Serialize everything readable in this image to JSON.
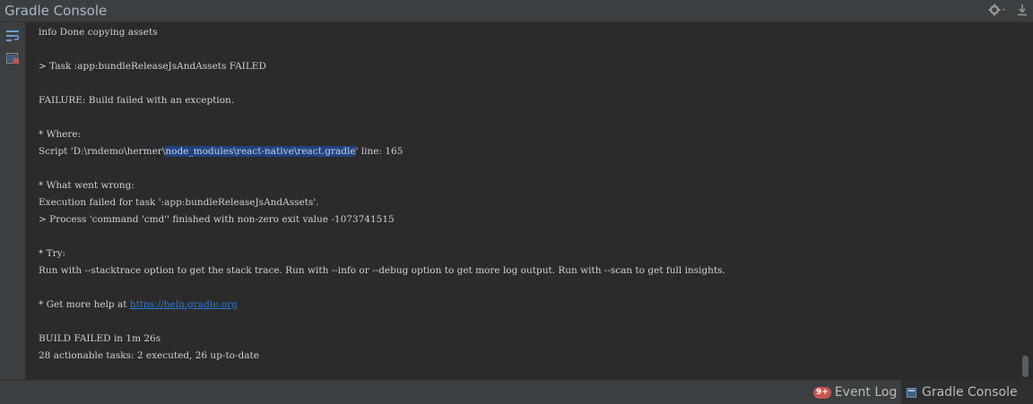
{
  "window": {
    "title": "Gradle Console"
  },
  "console": {
    "lines": [
      "info Done copying assets",
      "",
      "> Task :app:bundleReleaseJsAndAssets FAILED",
      "",
      "FAILURE: Build failed with an exception.",
      "",
      "* Where:",
      "",
      "",
      "* What went wrong:",
      "Execution failed for task ':app:bundleReleaseJsAndAssets'.",
      "> Process 'command 'cmd'' finished with non-zero exit value -1073741515",
      "",
      "* Try:",
      "Run with --stacktrace option to get the stack trace. Run with --info or --debug option to get more log output. Run with --scan to get full insights.",
      "",
      "",
      "",
      "BUILD FAILED in 1m 26s",
      "28 actionable tasks: 2 executed, 26 up-to-date"
    ],
    "where_line": {
      "prefix": "Script 'D:\\rndemo\\hermer\\",
      "selected": "node_modules\\react-native\\react.gradle",
      "suffix": "' line: 165"
    },
    "help_line": {
      "prefix": "* Get more help at ",
      "link": "https://help.gradle.org"
    }
  },
  "statusbar": {
    "event_log_badge": "9+",
    "event_log_label": "Event Log",
    "gradle_console_label": "Gradle Console"
  },
  "colors": {
    "background": "#2b2b2b",
    "panel": "#3c3f41",
    "text": "#c9d1d9",
    "selection": "#214283",
    "link": "#287bde",
    "badge": "#c75450"
  },
  "icons": {
    "settings": "gear-icon",
    "hide": "hide-panel-icon",
    "soft_wrap": "soft-wrap-icon",
    "clear": "clear-all-icon"
  }
}
